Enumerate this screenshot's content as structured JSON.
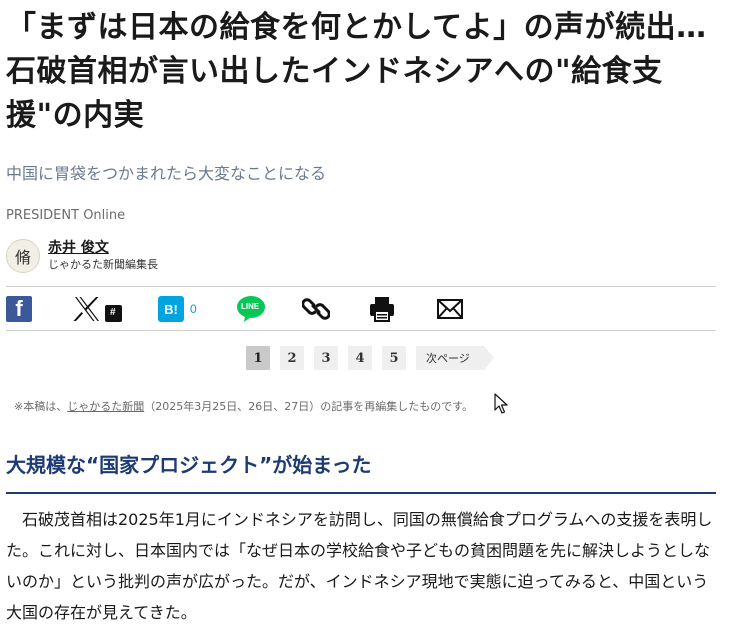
{
  "article": {
    "title": "「まずは日本の給食を何とかしてよ」の声が続出…石破首相が言い出したインドネシアへの\"給食支援\"の内実",
    "subtitle": "中国に胃袋をつかまれたら大変なことになる",
    "source": "PRESIDENT Online"
  },
  "author": {
    "avatar_text": "脩",
    "name": "赤井 俊文",
    "role": "じゃかるた新聞編集長"
  },
  "share": {
    "facebook_glyph": "f",
    "x_badge": "#",
    "hatena_label": "B!",
    "hatena_count": "0",
    "line_label": "LINE",
    "icons": [
      "facebook-icon",
      "x-icon",
      "hatena-bookmark-icon",
      "line-icon",
      "link-icon",
      "print-icon",
      "mail-icon"
    ]
  },
  "pagination": {
    "pages": [
      "1",
      "2",
      "3",
      "4",
      "5"
    ],
    "current": "1",
    "next_label": "次ページ"
  },
  "note": {
    "prefix": "※本稿は、",
    "link": "じゃかるた新聞",
    "suffix": "（2025年3月25日、26日、27日）の記事を再編集したものです。"
  },
  "section": {
    "heading": "大規模な“国家プロジェクト”が始まった",
    "paragraph": "石破茂首相は2025年1月にインドネシアを訪問し、同国の無償給食プログラムへの支援を表明した。これに対し、日本国内では「なぜ日本の学校給食や子どもの貧困問題を先に解決しようとしないのか」という批判の声が広がった。だが、インドネシア現地で実態に迫ってみると、中国という大国の存在が見えてきた。"
  },
  "colors": {
    "heading_navy": "#1d3b73",
    "facebook": "#3b5998",
    "hatena": "#00a4de",
    "line": "#06c755",
    "subtitle": "#6a7a90"
  }
}
